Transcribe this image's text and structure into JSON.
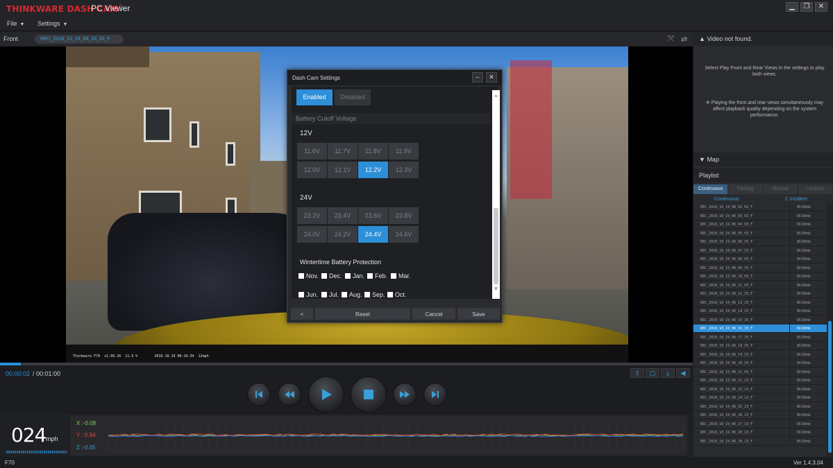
{
  "app": {
    "brand": "THINKWARE DASH CAM",
    "brand_mark": "™",
    "subtitle": "PC Viewer",
    "window_buttons": [
      "▁",
      "❐",
      "✕"
    ]
  },
  "menu": {
    "file": "File",
    "settings": "Settings"
  },
  "video_header": {
    "label": "Front",
    "file": "REC_2018_10_19_06_16_33_F"
  },
  "video_overlay": "Thinkware F70  v1.00.16  11.9 %        2018.10.19 06:16:34  12mph",
  "dialog": {
    "title": "Dash Cam Settings",
    "toggle": {
      "enabled": "Enabled",
      "disabled": "Disabled"
    },
    "section": "Battery Cutoff Voltage",
    "group12": {
      "label": "12V",
      "values": [
        "11.6V",
        "11.7V",
        "11.8V",
        "11.9V",
        "12.0V",
        "12.1V",
        "12.2V",
        "12.3V"
      ],
      "selected": "12.2V"
    },
    "group24": {
      "label": "24V",
      "values": [
        "23.2V",
        "23.4V",
        "23.6V",
        "23.8V",
        "24.0V",
        "24.2V",
        "24.4V",
        "24.6V"
      ],
      "selected": "24.4V"
    },
    "wintertime": "Wintertime Battery Protection",
    "months": [
      "Nov.",
      "Dec.",
      "Jan.",
      "Feb.",
      "Mar.",
      "Jun.",
      "Jul.",
      "Aug.",
      "Sep.",
      "Oct."
    ],
    "buttons": {
      "back": "<",
      "reset": "Reset",
      "cancel": "Cancel",
      "save": "Save"
    }
  },
  "playback": {
    "current": "00:00:02",
    "separator": "/",
    "total": "00:01:00",
    "progress": 0.03
  },
  "telemetry": {
    "speed": "024",
    "unit": "mph",
    "x": "X :-0.08",
    "y": "Y : 0.94",
    "z": "Z :-0.05"
  },
  "colors": {
    "accent": "#2d8fd8",
    "brand": "#d9282f",
    "x": "#7bd35a",
    "y": "#e4473d",
    "z": "#3a9fd8"
  },
  "right_panel": {
    "video_header": "Video not found.",
    "msg1": "Select Play Front and Rear Views in the settings to play both views.",
    "msg2": "※ Playing the front and rear views simultaneously may affect playback quality depending on the system performance.",
    "map": "Map",
    "playlist": "Playlist",
    "tabs": [
      "Continuous",
      "Parking",
      "Manual",
      "Location"
    ],
    "columns": {
      "left": "Continuous",
      "right": "C Incident"
    },
    "files": [
      "REC_2018_10_19_06_02_02_F",
      "REC_2018_10_19_06_03_03_F",
      "REC_2018_10_19_06_04_03_F",
      "REC_2018_10_19_06_05_03_F",
      "REC_2018_10_19_06_06_33_F",
      "REC_2018_10_19_06_07_33_F",
      "REC_2018_10_19_06_08_03_F",
      "REC_2018_10_19_06_09_33_F",
      "REC_2018_10_19_06_10_03_F",
      "REC_2018_10_19_06_11_03_F",
      "REC_2018_10_19_06_12_33_F",
      "REC_2018_10_19_06_13_33_F",
      "REC_2018_10_19_06_14_33_F",
      "REC_2018_10_19_06_15_33_F",
      "REC_2018_10_19_06_16_33_F",
      "REC_2018_10_19_06_17_33_F",
      "REC_2018_10_19_06_18_33_F",
      "REC_2018_10_19_06_19_33_F",
      "REC_2018_10_19_06_20_33_F",
      "REC_2018_10_19_06_21_03_F",
      "REC_2018_10_19_06_22_13_F",
      "REC_2018_10_19_06_23_13_F",
      "REC_2018_10_19_06_24_13_F",
      "REC_2018_10_19_06_25_13_F",
      "REC_2018_10_19_06_26_13_F",
      "REC_2018_10_19_06_27_13_F",
      "REC_2018_10_19_06_28_13_F",
      "REC_2018_10_19_06_29_13_F"
    ],
    "file_size": "80.00mb",
    "selected_index": 14
  },
  "status": {
    "model": "F70",
    "version": "Ver 1.4.3.04"
  }
}
